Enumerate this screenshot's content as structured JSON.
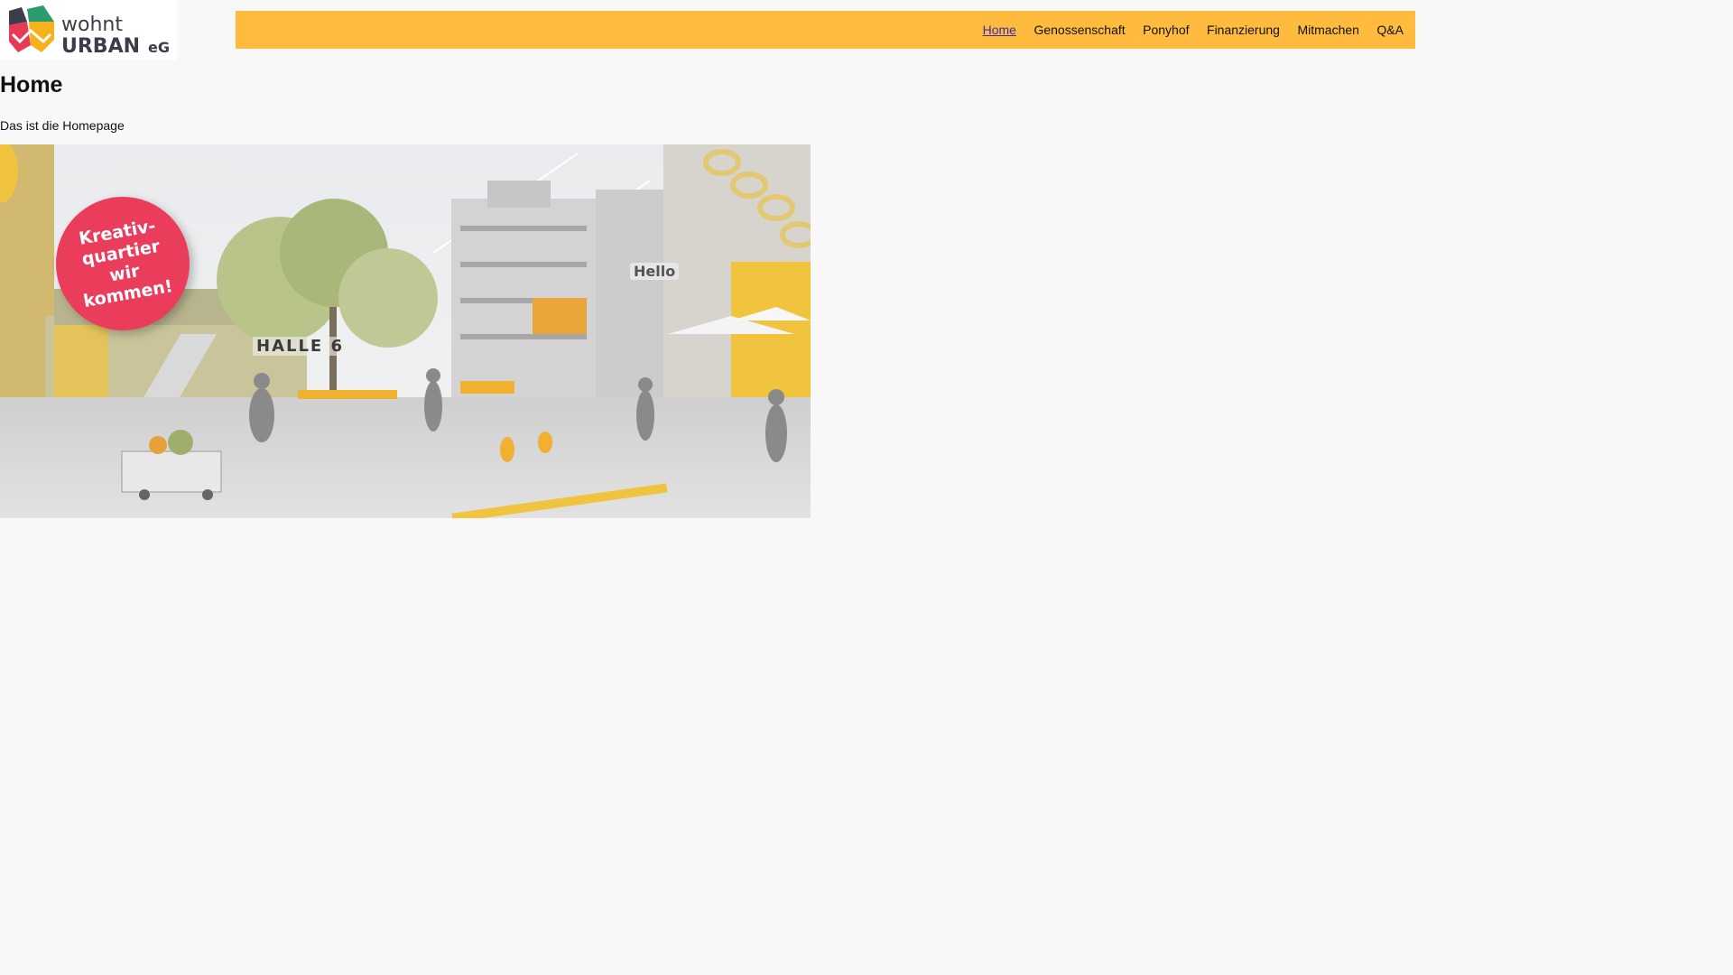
{
  "header": {
    "logo": {
      "line1": "wohnt",
      "line2": "URBAN",
      "suffix": "eG",
      "colors": {
        "green": "#2a9d6f",
        "red": "#e63a55",
        "yellow": "#f5b21d",
        "text": "#3c3c4a"
      }
    },
    "nav": [
      {
        "label": "Home",
        "active": true
      },
      {
        "label": "Genossenschaft",
        "active": false
      },
      {
        "label": "Ponyhof",
        "active": false
      },
      {
        "label": "Finanzierung",
        "active": false
      },
      {
        "label": "Mitmachen",
        "active": false
      },
      {
        "label": "Q&A",
        "active": false
      }
    ],
    "nav_bar_color": "#ffbb3d"
  },
  "page": {
    "title": "Home",
    "intro": "Das ist die Homepage"
  },
  "hero": {
    "badge_lines": [
      "Kreativ-",
      "quartier wir",
      "kommen!"
    ],
    "badge_color": "#ea3d5b",
    "wall_sign": "HALLE 6",
    "hello_sign": "Hello"
  }
}
